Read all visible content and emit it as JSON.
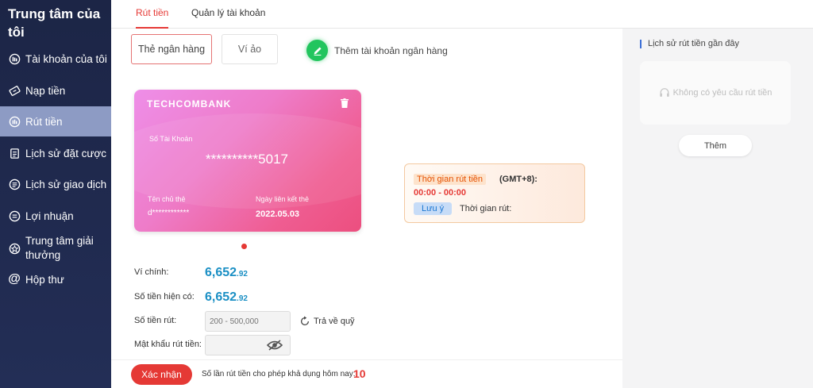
{
  "sidebar": {
    "title": "Trung tâm của tôi",
    "items": [
      {
        "label": "Tài khoản của tôi",
        "icon": "account-icon"
      },
      {
        "label": "Nạp tiền",
        "icon": "deposit-icon"
      },
      {
        "label": "Rút tiền",
        "icon": "withdraw-icon",
        "active": true
      },
      {
        "label": "Lịch sử đặt cược",
        "icon": "bet-history-icon"
      },
      {
        "label": "Lịch sử giao dịch",
        "icon": "transaction-history-icon"
      },
      {
        "label": "Lợi nhuận",
        "icon": "profit-icon"
      },
      {
        "label": "Trung tâm giải thưởng",
        "icon": "reward-icon"
      },
      {
        "label": "Hộp thư",
        "icon": "mail-icon"
      }
    ]
  },
  "tabs": [
    {
      "label": "Rút tiền",
      "active": true
    },
    {
      "label": "Quản lý tài khoản",
      "active": false
    }
  ],
  "method_tabs": {
    "bank_card": "Thẻ ngân hàng",
    "e_wallet": "Ví ảo",
    "add_bank": "Thêm tài khoản ngân hàng"
  },
  "card": {
    "bank": "TECHCOMBANK",
    "account_label": "Số Tài Khoản",
    "account_number": "**********5017",
    "holder_label": "Tên chủ thẻ",
    "holder_name": "d************",
    "linked_label": "Ngày liên kết thẻ",
    "linked_date": "2022.05.03"
  },
  "withdraw_time": {
    "label": "Thời gian rút tiền",
    "timezone": "(GMT+8):",
    "hours": "00:00 - 00:00",
    "note_badge": "Lưu ý",
    "note_text": "Thời gian rút:"
  },
  "wallet": {
    "main_label": "Ví chính:",
    "main_int": "6,652",
    "main_dec": ".92",
    "available_label": "Số tiền hiện có:",
    "available_int": "6,652",
    "available_dec": ".92",
    "amount_label": "Số tiền rút:",
    "amount_placeholder": "200 - 500,000",
    "refund_label": "Trả về quỹ",
    "password_label": "Mật khẩu rút tiền:",
    "password_placeholder": ""
  },
  "footer": {
    "confirm_label": "Xác nhận",
    "limit_text": "Số lần rút tiền cho phép khả dụng hôm nay:",
    "limit_value": "10"
  },
  "history": {
    "title": "Lịch sử rút tiền gần đây",
    "empty_text": "Không có yêu cầu rút tiền",
    "more_label": "Thêm"
  },
  "colors": {
    "accent": "#e53935",
    "sidebar": "#1c2546",
    "sidebar_active": "#8d9bc4",
    "amount": "#1a8fc4",
    "add_button": "#22c55e"
  }
}
